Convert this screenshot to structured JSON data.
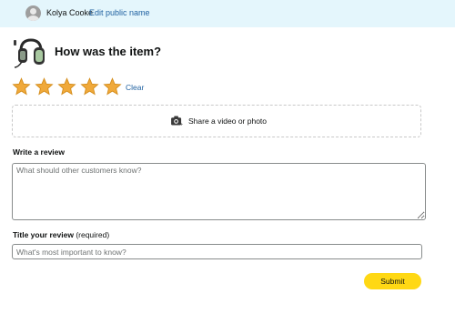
{
  "header": {
    "user_name": "Kolya Cooke",
    "edit_label": "Edit public name"
  },
  "product": {
    "question": "How was the item?",
    "image_icon": "headset-image"
  },
  "rating": {
    "value": 5,
    "max": 5,
    "clear_label": "Clear",
    "star_color": "#f0a93a"
  },
  "media": {
    "label": "Share a video or photo",
    "icon": "camera-icon"
  },
  "review": {
    "label": "Write a review",
    "placeholder": "What should other customers know?"
  },
  "title_field": {
    "label": "Title your review",
    "required_label": "(required)",
    "placeholder": "What's most important to know?"
  },
  "submit_label": "Submit",
  "colors": {
    "header_bg": "#e4f6fc",
    "link": "#2162a1",
    "submit_bg": "#ffd814"
  }
}
